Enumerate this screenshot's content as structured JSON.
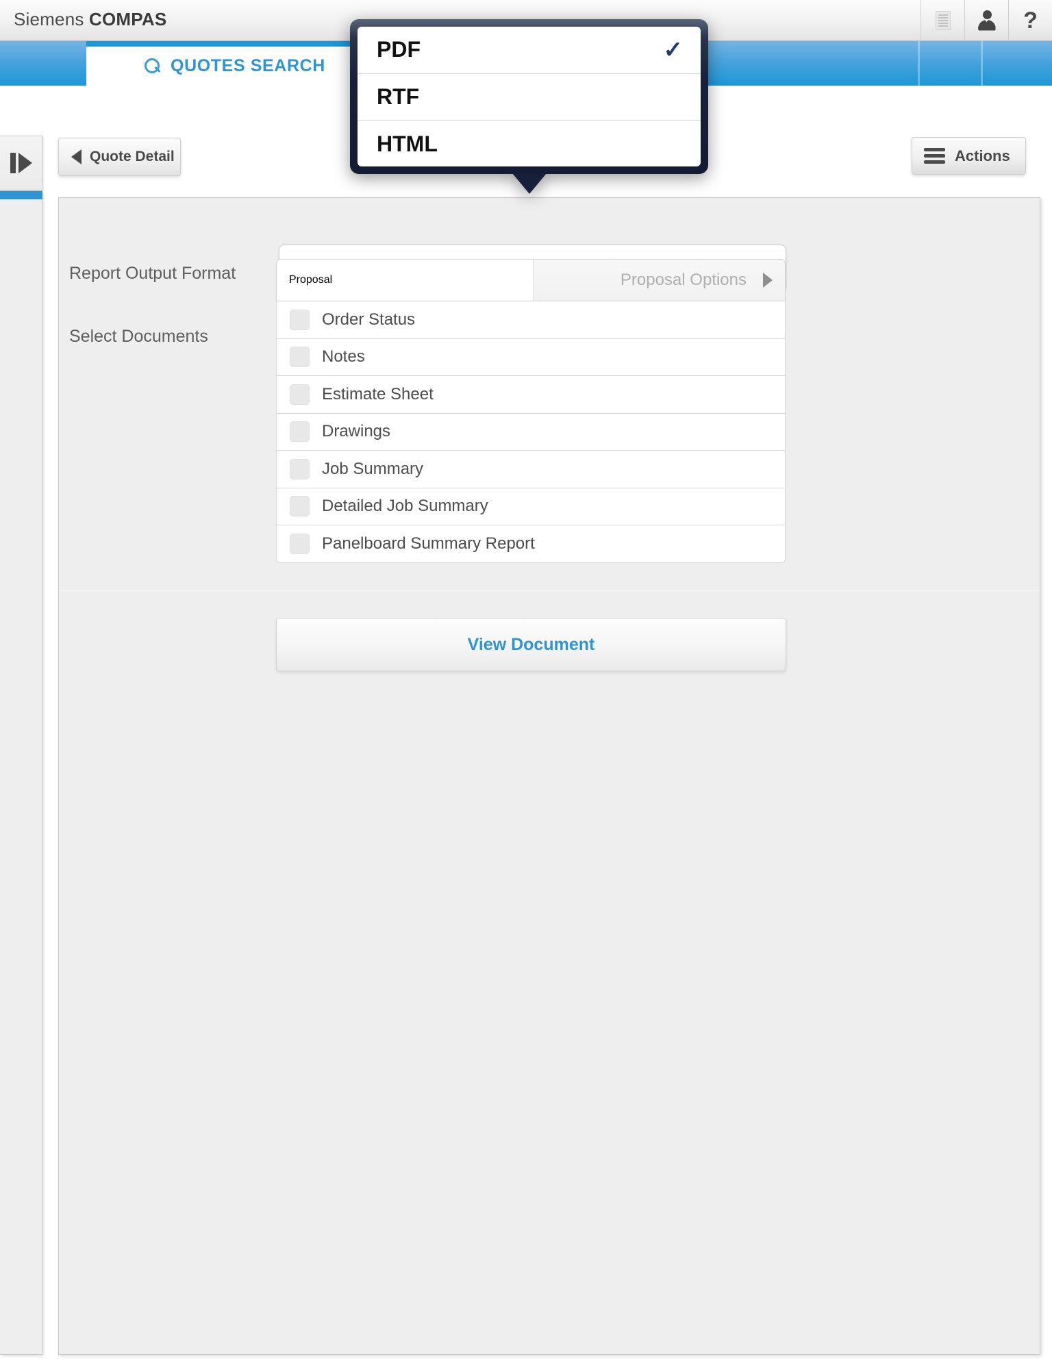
{
  "header": {
    "title_prefix": "Siemens ",
    "title_bold": "COMPAS",
    "icons": [
      {
        "name": "document-list-icon",
        "label": "Documents"
      },
      {
        "name": "user-icon",
        "label": "User"
      },
      {
        "name": "help-icon",
        "glyph": "?"
      }
    ]
  },
  "tabs": [
    {
      "label": "QUOTES SEARCH",
      "icon": "search-icon",
      "active": true
    },
    {
      "label": "",
      "icon": "catalog-book-icon",
      "active": false
    }
  ],
  "toolbar": {
    "sidebar_toggle_icon": "panel-expand-icon",
    "back_button_label": "Quote Detail",
    "actions_button_label": "Actions",
    "actions_icon": "hamburger-menu-icon"
  },
  "form": {
    "report_format": {
      "label": "Report Output Format",
      "value": "PDF"
    },
    "select_documents": {
      "label": "Select Documents",
      "proposal_options_label": "Proposal Options",
      "items": [
        {
          "label": "Proposal",
          "checked": false,
          "has_options": true
        },
        {
          "label": "Order Status",
          "checked": false,
          "has_options": false
        },
        {
          "label": "Notes",
          "checked": false,
          "has_options": false
        },
        {
          "label": "Estimate Sheet",
          "checked": false,
          "has_options": false
        },
        {
          "label": "Drawings",
          "checked": false,
          "has_options": false
        },
        {
          "label": "Job Summary",
          "checked": false,
          "has_options": false
        },
        {
          "label": "Detailed Job Summary",
          "checked": false,
          "has_options": false
        },
        {
          "label": "Panelboard Summary Report",
          "checked": false,
          "has_options": false
        }
      ]
    },
    "view_document_button_label": "View Document"
  },
  "dropdown_popup": {
    "open": true,
    "selected": "PDF",
    "check_glyph": "✓",
    "options": [
      {
        "label": "PDF",
        "selected": true
      },
      {
        "label": "RTF",
        "selected": false
      },
      {
        "label": "HTML",
        "selected": false
      }
    ]
  },
  "colors": {
    "accent_blue": "#2e95d4",
    "tabbar_blue": "#1d97d6",
    "popup_border_navy": "#16203a",
    "panel_grey": "#eeeeee",
    "text_grey": "#5e5e5e"
  }
}
